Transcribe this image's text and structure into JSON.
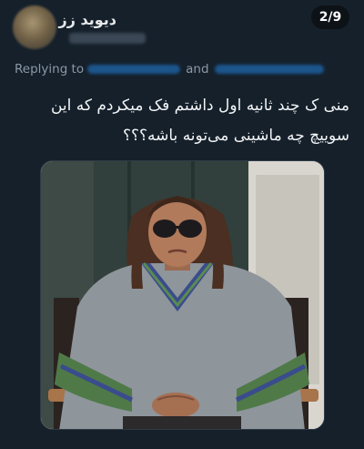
{
  "author": {
    "name": "دیوید زز"
  },
  "thread": {
    "counter": "2/9"
  },
  "reply": {
    "prefix": "Replying to",
    "connector": "and"
  },
  "tweet": {
    "text": "منی ک چند ثانیه اول داشتم فک میکردم که این سوییچ چه ماشینی می‌تونه باشه؟؟؟"
  },
  "icons": {
    "avatar": "avatar-image",
    "media": "meme-photo"
  },
  "colors": {
    "background": "#15202b",
    "link": "#1d9bf0",
    "muted": "#8b98a5"
  }
}
